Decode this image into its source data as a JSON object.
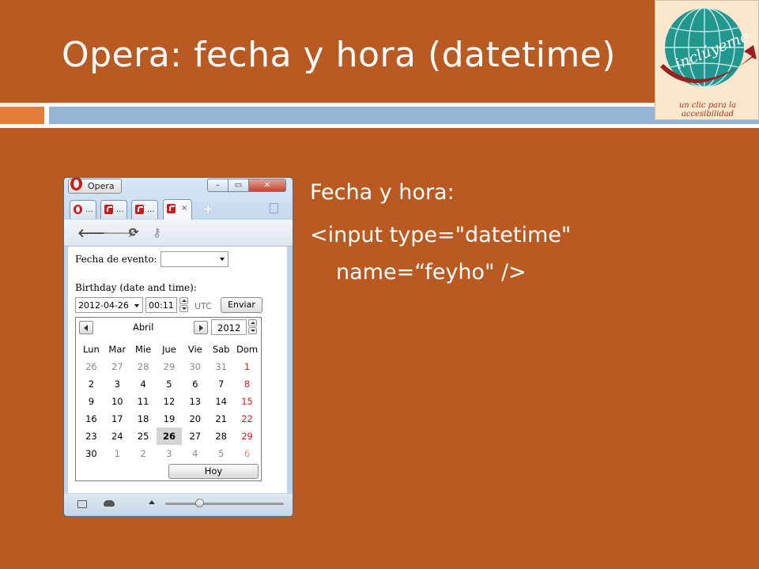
{
  "slide": {
    "title": "Opera: fecha y hora (datetime)",
    "body_line1": "Fecha y hora:",
    "body_line2": "<input type=\"datetime\"",
    "body_line3": "name=“feyho\" />"
  },
  "logo": {
    "wordmark": "inclúyeme",
    "caption_line1": "un clic para la",
    "caption_line2": "accesibilidad"
  },
  "window": {
    "opera_menu_label": "Opera",
    "controls": {
      "minimize": "–",
      "maximize": "▭",
      "close": "✕"
    },
    "tabs": [
      {
        "label": "...",
        "favicon": "opera-icon"
      },
      {
        "label": "...",
        "favicon": "page-icon"
      },
      {
        "label": "...",
        "favicon": "page-icon"
      },
      {
        "label": "×",
        "favicon": "page-icon",
        "active": true
      }
    ],
    "new_tab": "+",
    "toolbar": {
      "back": "🡐",
      "forward": "🡒",
      "reload": "⟳",
      "key": "⚷"
    }
  },
  "form": {
    "fecha_label": "Fecha de evento:",
    "birthday_label": "Birthday (date and time):",
    "date_value": "2012-04-26",
    "time_value": "00:11",
    "tz": "UTC",
    "submit_label": "Enviar"
  },
  "calendar": {
    "month": "Abril",
    "year": "2012",
    "weekdays": [
      "Lun",
      "Mar",
      "Mie",
      "Jue",
      "Vie",
      "Sab",
      "Dom"
    ],
    "weeks": [
      [
        "26",
        "27",
        "28",
        "29",
        "30",
        "31",
        "1"
      ],
      [
        "2",
        "3",
        "4",
        "5",
        "6",
        "7",
        "8"
      ],
      [
        "9",
        "10",
        "11",
        "12",
        "13",
        "14",
        "15"
      ],
      [
        "16",
        "17",
        "18",
        "19",
        "20",
        "21",
        "22"
      ],
      [
        "23",
        "24",
        "25",
        "26",
        "27",
        "28",
        "29"
      ],
      [
        "30",
        "1",
        "2",
        "3",
        "4",
        "5",
        "6"
      ]
    ],
    "selected": {
      "week": 4,
      "day": 3
    },
    "today_label": "Hoy"
  },
  "colors": {
    "background": "#b85a22",
    "accent_orange": "#e37e3a",
    "accent_blue": "#95b4d6",
    "sunday_red": "#d01d1d"
  }
}
